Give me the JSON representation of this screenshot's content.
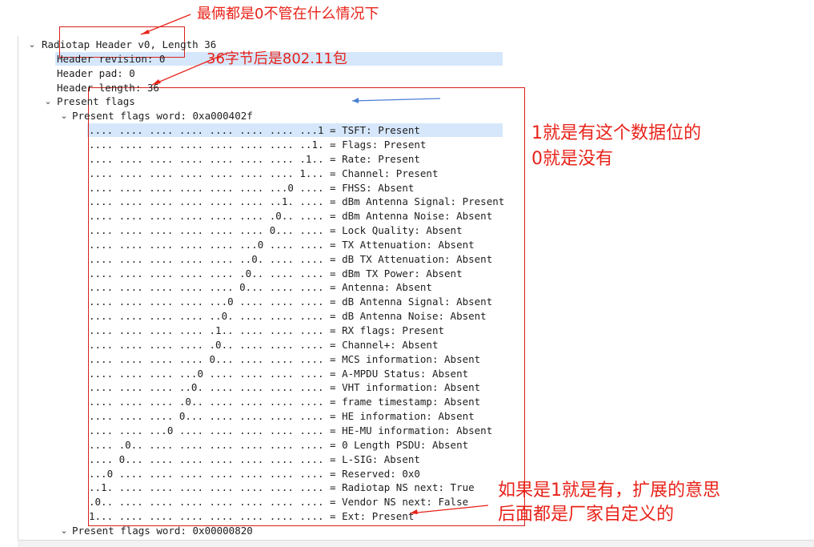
{
  "tree": [
    {
      "depth": 0,
      "expander": "expanded",
      "text": "Radiotap Header v0, Length 36",
      "highlight": false
    },
    {
      "depth": 1,
      "expander": "none",
      "text": "Header revision: 0",
      "highlight": true
    },
    {
      "depth": 1,
      "expander": "none",
      "text": "Header pad: 0",
      "highlight": false
    },
    {
      "depth": 1,
      "expander": "none",
      "text": "Header length: 36",
      "highlight": false
    },
    {
      "depth": 1,
      "expander": "expanded",
      "text": "Present flags",
      "highlight": false
    },
    {
      "depth": 2,
      "expander": "expanded",
      "text": "Present flags word: 0xa000402f",
      "highlight": false
    },
    {
      "depth": 3,
      "expander": "none",
      "text": ".... .... .... .... .... .... .... ...1 = TSFT: Present",
      "highlight": true
    },
    {
      "depth": 3,
      "expander": "none",
      "text": ".... .... .... .... .... .... .... ..1. = Flags: Present",
      "highlight": false
    },
    {
      "depth": 3,
      "expander": "none",
      "text": ".... .... .... .... .... .... .... .1.. = Rate: Present",
      "highlight": false
    },
    {
      "depth": 3,
      "expander": "none",
      "text": ".... .... .... .... .... .... .... 1... = Channel: Present",
      "highlight": false
    },
    {
      "depth": 3,
      "expander": "none",
      "text": ".... .... .... .... .... .... ...0 .... = FHSS: Absent",
      "highlight": false
    },
    {
      "depth": 3,
      "expander": "none",
      "text": ".... .... .... .... .... .... ..1. .... = dBm Antenna Signal: Present",
      "highlight": false
    },
    {
      "depth": 3,
      "expander": "none",
      "text": ".... .... .... .... .... .... .0.. .... = dBm Antenna Noise: Absent",
      "highlight": false
    },
    {
      "depth": 3,
      "expander": "none",
      "text": ".... .... .... .... .... .... 0... .... = Lock Quality: Absent",
      "highlight": false
    },
    {
      "depth": 3,
      "expander": "none",
      "text": ".... .... .... .... .... ...0 .... .... = TX Attenuation: Absent",
      "highlight": false
    },
    {
      "depth": 3,
      "expander": "none",
      "text": ".... .... .... .... .... ..0. .... .... = dB TX Attenuation: Absent",
      "highlight": false
    },
    {
      "depth": 3,
      "expander": "none",
      "text": ".... .... .... .... .... .0.. .... .... = dBm TX Power: Absent",
      "highlight": false
    },
    {
      "depth": 3,
      "expander": "none",
      "text": ".... .... .... .... .... 0... .... .... = Antenna: Absent",
      "highlight": false
    },
    {
      "depth": 3,
      "expander": "none",
      "text": ".... .... .... .... ...0 .... .... .... = dB Antenna Signal: Absent",
      "highlight": false
    },
    {
      "depth": 3,
      "expander": "none",
      "text": ".... .... .... .... ..0. .... .... .... = dB Antenna Noise: Absent",
      "highlight": false
    },
    {
      "depth": 3,
      "expander": "none",
      "text": ".... .... .... .... .1.. .... .... .... = RX flags: Present",
      "highlight": false
    },
    {
      "depth": 3,
      "expander": "none",
      "text": ".... .... .... .... .0.. .... .... .... = Channel+: Absent",
      "highlight": false
    },
    {
      "depth": 3,
      "expander": "none",
      "text": ".... .... .... .... 0... .... .... .... = MCS information: Absent",
      "highlight": false
    },
    {
      "depth": 3,
      "expander": "none",
      "text": ".... .... .... ...0 .... .... .... .... = A-MPDU Status: Absent",
      "highlight": false
    },
    {
      "depth": 3,
      "expander": "none",
      "text": ".... .... .... ..0. .... .... .... .... = VHT information: Absent",
      "highlight": false
    },
    {
      "depth": 3,
      "expander": "none",
      "text": ".... .... .... .0.. .... .... .... .... = frame timestamp: Absent",
      "highlight": false
    },
    {
      "depth": 3,
      "expander": "none",
      "text": ".... .... .... 0... .... .... .... .... = HE information: Absent",
      "highlight": false
    },
    {
      "depth": 3,
      "expander": "none",
      "text": ".... .... ...0 .... .... .... .... .... = HE-MU information: Absent",
      "highlight": false
    },
    {
      "depth": 3,
      "expander": "none",
      "text": ".... .0.. .... .... .... .... .... .... = 0 Length PSDU: Absent",
      "highlight": false
    },
    {
      "depth": 3,
      "expander": "none",
      "text": ".... 0... .... .... .... .... .... .... = L-SIG: Absent",
      "highlight": false
    },
    {
      "depth": 3,
      "expander": "none",
      "text": "...0 .... .... .... .... .... .... .... = Reserved: 0x0",
      "highlight": false
    },
    {
      "depth": 3,
      "expander": "none",
      "text": "..1. .... .... .... .... .... .... .... = Radiotap NS next: True",
      "highlight": false
    },
    {
      "depth": 3,
      "expander": "none",
      "text": ".0.. .... .... .... .... .... .... .... = Vendor NS next: False",
      "highlight": false
    },
    {
      "depth": 3,
      "expander": "none",
      "text": "1... .... .... .... .... .... .... .... = Ext: Present",
      "highlight": false
    },
    {
      "depth": 2,
      "expander": "expanded",
      "text": "Present flags word: 0x00000820",
      "highlight": false
    }
  ],
  "annotations": {
    "top_note": "最俩都是0不管在什么情况下",
    "length_note": "36字节后是802.11包",
    "bits_note_line1": "1就是有这个数据位的",
    "bits_note_line2": "0就是没有",
    "ext_note_line1": "如果是1就是有，扩展的意思",
    "ext_note_line2": "后面都是厂家自定义的"
  },
  "colors": {
    "annotation_red": "#e8231a",
    "row_highlight": "#d6e7fb",
    "arrow_blue": "#4a7fd4"
  },
  "icons": {
    "expanded": "chevron-down-icon",
    "collapsed": "chevron-right-icon"
  }
}
